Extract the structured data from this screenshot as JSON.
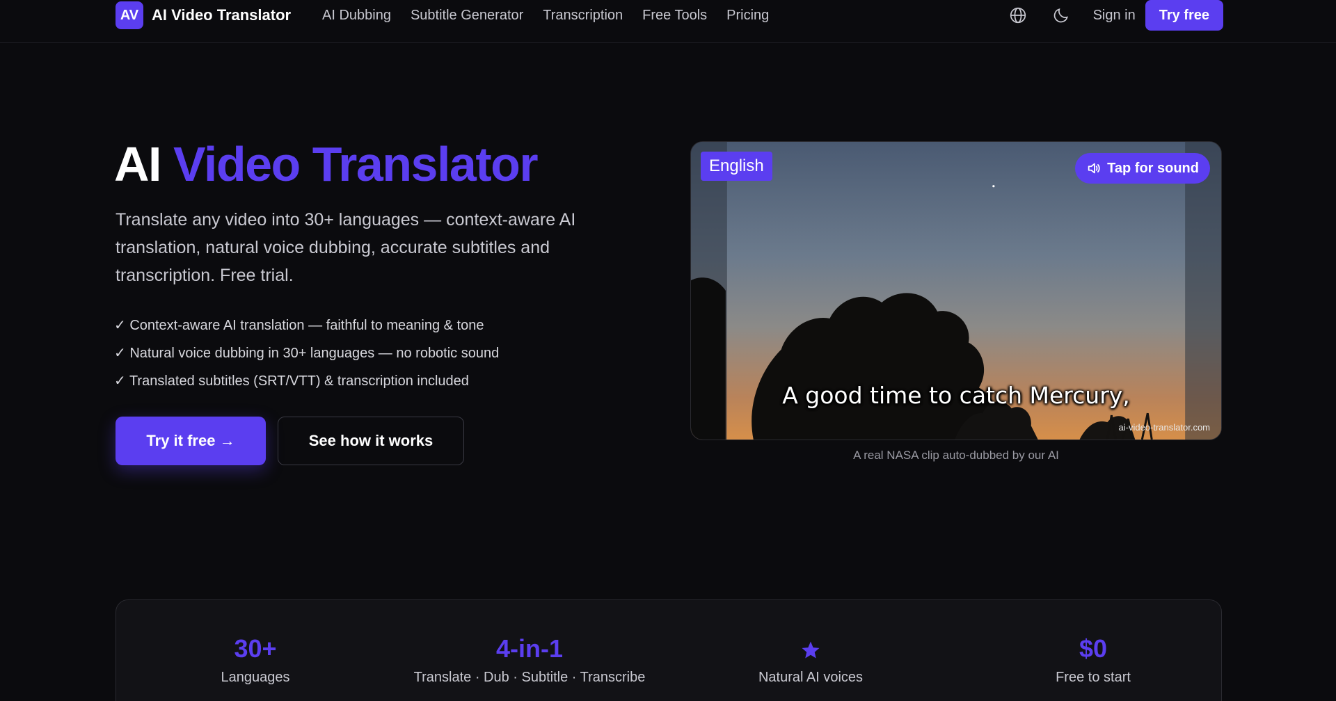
{
  "header": {
    "logo_mark": "AV",
    "logo_text": "AI Video Translator",
    "nav": [
      "AI Dubbing",
      "Subtitle Generator",
      "Transcription",
      "Free Tools",
      "Pricing"
    ],
    "sign_in": "Sign in",
    "try_free": "Try free",
    "icons": [
      "globe-icon",
      "moon-icon"
    ]
  },
  "hero": {
    "title_plain": "AI",
    "title_accent": "Video Translator",
    "subtitle": "Translate any video into 30+ languages — context-aware AI translation, natural voice dubbing, accurate subtitles and transcription. Free trial.",
    "features": [
      "✓ Context-aware AI translation — faithful to meaning & tone",
      "✓ Natural voice dubbing in 30+ languages — no robotic sound",
      "✓ Translated subtitles (SRT/VTT) & transcription included"
    ],
    "cta_primary": "Try it free →",
    "cta_secondary": "See how it works"
  },
  "video": {
    "language": "English",
    "sound_button": "Tap for sound",
    "subtitle": "A good time to catch Mercury,",
    "watermark": "ai-video-translator.com",
    "caption": "A real NASA clip auto-dubbed by our AI"
  },
  "stats": [
    {
      "value": "30+",
      "label": "Languages"
    },
    {
      "value": "4-in-1",
      "label": "Translate · Dub · Subtitle · Transcribe"
    },
    {
      "value": "",
      "label": "Natural AI voices",
      "icon": "star-icon"
    },
    {
      "value": "$0",
      "label": "Free to start"
    }
  ],
  "colors": {
    "background": "#0b0b0e",
    "accent": "#5b3ef0",
    "text_muted": "#c9c9d1"
  }
}
